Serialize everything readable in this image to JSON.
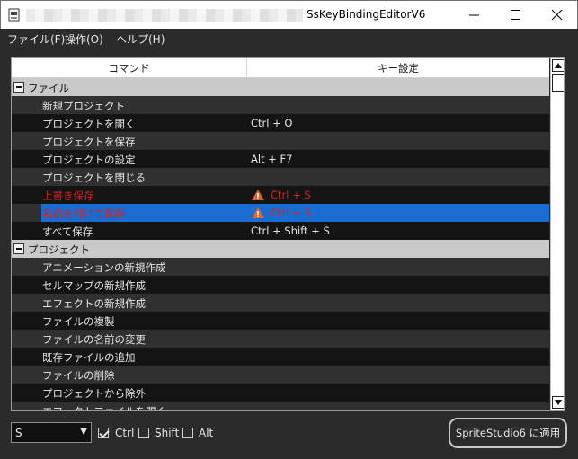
{
  "window": {
    "title": "SsKeyBindingEditorV6"
  },
  "menu": [
    {
      "label": "ファイル(F)"
    },
    {
      "label": "操作(O)"
    },
    {
      "label": "ヘルプ(H)"
    }
  ],
  "table": {
    "columns": [
      "コマンド",
      "キー設定"
    ],
    "rows": [
      {
        "type": "group",
        "cmd": "ファイル",
        "key": ""
      },
      {
        "type": "item",
        "cmd": "新規プロジェクト",
        "key": ""
      },
      {
        "type": "item",
        "cmd": "プロジェクトを開く",
        "key": "Ctrl + O"
      },
      {
        "type": "item",
        "cmd": "プロジェクトを保存",
        "key": ""
      },
      {
        "type": "item",
        "cmd": "プロジェクトの設定",
        "key": "Alt + F7"
      },
      {
        "type": "item",
        "cmd": "プロジェクトを閉じる",
        "key": ""
      },
      {
        "type": "item",
        "cmd": "上書き保存",
        "key": "Ctrl + S",
        "conflict": true
      },
      {
        "type": "item",
        "cmd": "名前を付けて保存",
        "key": "Ctrl + S",
        "conflict": true,
        "selected": true
      },
      {
        "type": "item",
        "cmd": "すべて保存",
        "key": "Ctrl + Shift + S"
      },
      {
        "type": "group",
        "cmd": "プロジェクト",
        "key": ""
      },
      {
        "type": "item",
        "cmd": "アニメーションの新規作成",
        "key": ""
      },
      {
        "type": "item",
        "cmd": "セルマップの新規作成",
        "key": ""
      },
      {
        "type": "item",
        "cmd": "エフェクトの新規作成",
        "key": ""
      },
      {
        "type": "item",
        "cmd": "ファイルの複製",
        "key": ""
      },
      {
        "type": "item",
        "cmd": "ファイルの名前の変更",
        "key": ""
      },
      {
        "type": "item",
        "cmd": "既存ファイルの追加",
        "key": ""
      },
      {
        "type": "item",
        "cmd": "ファイルの削除",
        "key": ""
      },
      {
        "type": "item",
        "cmd": "プロジェクトから除外",
        "key": ""
      },
      {
        "type": "item",
        "cmd": "エフェクトファイルを開く",
        "key": ""
      }
    ]
  },
  "bottom": {
    "key_value": "S",
    "ctrl": {
      "label": "Ctrl",
      "checked": true
    },
    "shift": {
      "label": "Shift",
      "checked": false
    },
    "alt": {
      "label": "Alt",
      "checked": false
    },
    "apply_label": "SpriteStudio6 に適用"
  },
  "colors": {
    "selection": "#1a6dd0",
    "conflict": "#d82020",
    "warning": "#e0652a"
  }
}
